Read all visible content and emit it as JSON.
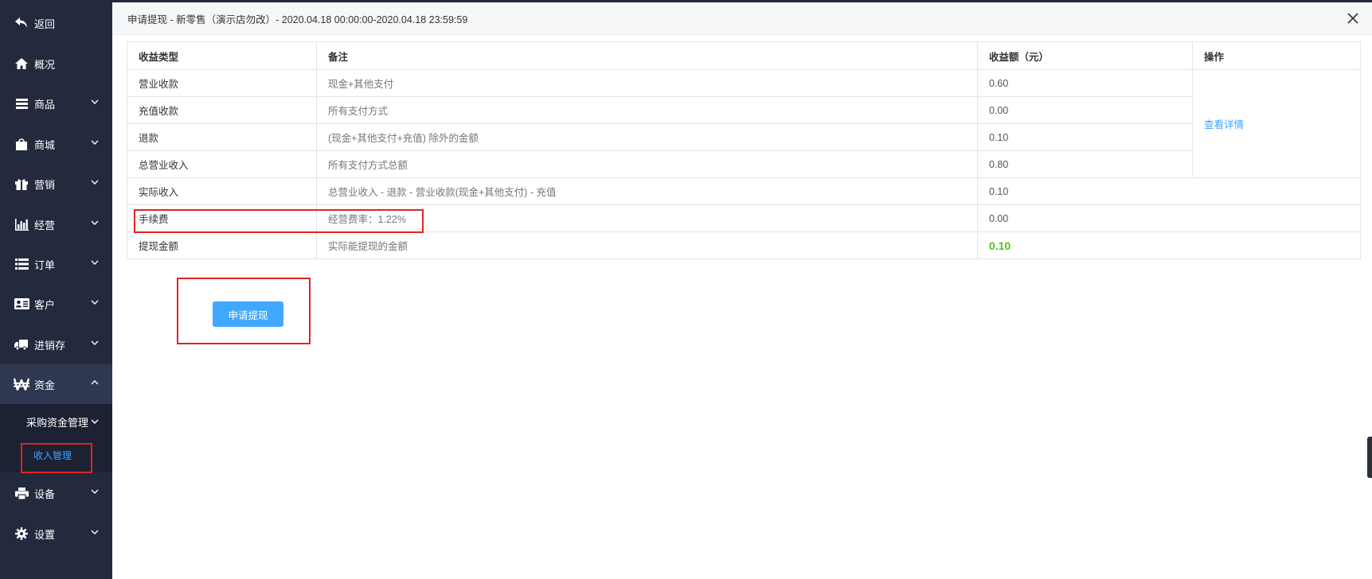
{
  "sidebar": {
    "items": [
      {
        "label": "返回",
        "icon": "back-arrow-icon"
      },
      {
        "label": "概况",
        "icon": "home-icon"
      },
      {
        "label": "商品",
        "icon": "list-icon"
      },
      {
        "label": "商城",
        "icon": "shopping-bag-icon"
      },
      {
        "label": "营销",
        "icon": "gift-icon"
      },
      {
        "label": "经营",
        "icon": "bar-chart-icon"
      },
      {
        "label": "订单",
        "icon": "order-list-icon"
      },
      {
        "label": "客户",
        "icon": "id-card-icon"
      },
      {
        "label": "进销存",
        "icon": "truck-icon"
      },
      {
        "label": "资金",
        "icon": "won-icon"
      },
      {
        "label": "设备",
        "icon": "printer-icon"
      },
      {
        "label": "设置",
        "icon": "gear-icon"
      }
    ],
    "submenu": {
      "group_label": "采购资金管理",
      "current_label": "收入管理"
    }
  },
  "dialog": {
    "title": "申请提现 - 新零售（演示店勿改）- 2020.04.18 00:00:00-2020.04.18 23:59:59"
  },
  "table": {
    "headers": {
      "type": "收益类型",
      "note": "备注",
      "amount": "收益额（元）",
      "action": "操作"
    },
    "rows": [
      {
        "type": "营业收款",
        "note": "现金+其他支付",
        "amount": "0.60"
      },
      {
        "type": "充值收款",
        "note": "所有支付方式",
        "amount": "0.00"
      },
      {
        "type": "退款",
        "note": "(现金+其他支付+充值) 除外的金额",
        "amount": "0.10"
      },
      {
        "type": "总营业收入",
        "note": "所有支付方式总额",
        "amount": "0.80"
      },
      {
        "type": "实际收入",
        "note": "总营业收入 - 退款 - 营业收款(现金+其他支付) - 充值",
        "amount": "0.10"
      },
      {
        "type": "手续费",
        "note": "经营费率：1.22%",
        "amount": "0.00"
      },
      {
        "type": "提现金额",
        "note": "实际能提现的金额",
        "amount": "0.10"
      }
    ],
    "action_link": "查看详情"
  },
  "apply_button": "申请提现",
  "colors": {
    "sidebar_bg": "#232a3d",
    "accent_blue": "#40a9ff",
    "highlight_red": "#e62222",
    "amount_green": "#52c41a"
  }
}
